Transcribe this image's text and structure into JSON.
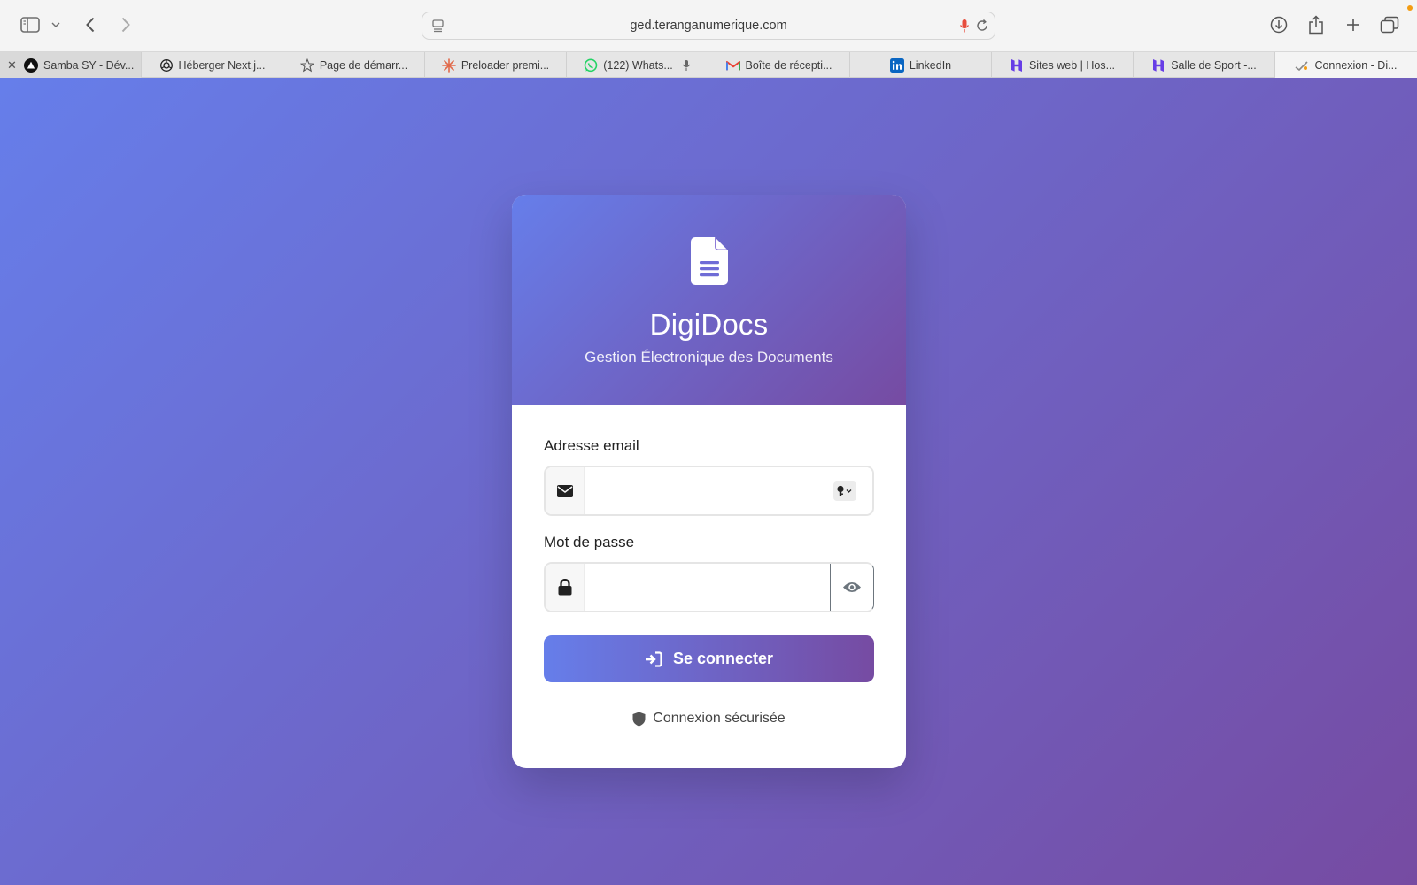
{
  "browser": {
    "url": "ged.teranganumerique.com",
    "tabs": [
      {
        "label": "Samba SY - Dév...",
        "icon": "triangle-logo-icon"
      },
      {
        "label": "Héberger Next.j...",
        "icon": "openai-icon"
      },
      {
        "label": "Page de démarr...",
        "icon": "star-icon"
      },
      {
        "label": "Preloader premi...",
        "icon": "spark-icon"
      },
      {
        "label": "(122) Whats...",
        "icon": "whatsapp-icon"
      },
      {
        "label": "Boîte de récepti...",
        "icon": "gmail-icon"
      },
      {
        "label": "LinkedIn",
        "icon": "linkedin-icon"
      },
      {
        "label": "Sites web | Hos...",
        "icon": "hostinger-icon"
      },
      {
        "label": "Salle de Sport -...",
        "icon": "hostinger-icon"
      },
      {
        "label": "Connexion - Di...",
        "icon": "digidocs-icon"
      }
    ]
  },
  "login": {
    "brand": "DigiDocs",
    "tagline": "Gestion Électronique des Documents",
    "email_label": "Adresse email",
    "email_value": "",
    "password_label": "Mot de passe",
    "password_value": "",
    "submit_label": "Se connecter",
    "secure_label": "Connexion sécurisée"
  },
  "colors": {
    "gradient_start": "#667eea",
    "gradient_end": "#764ba2"
  }
}
